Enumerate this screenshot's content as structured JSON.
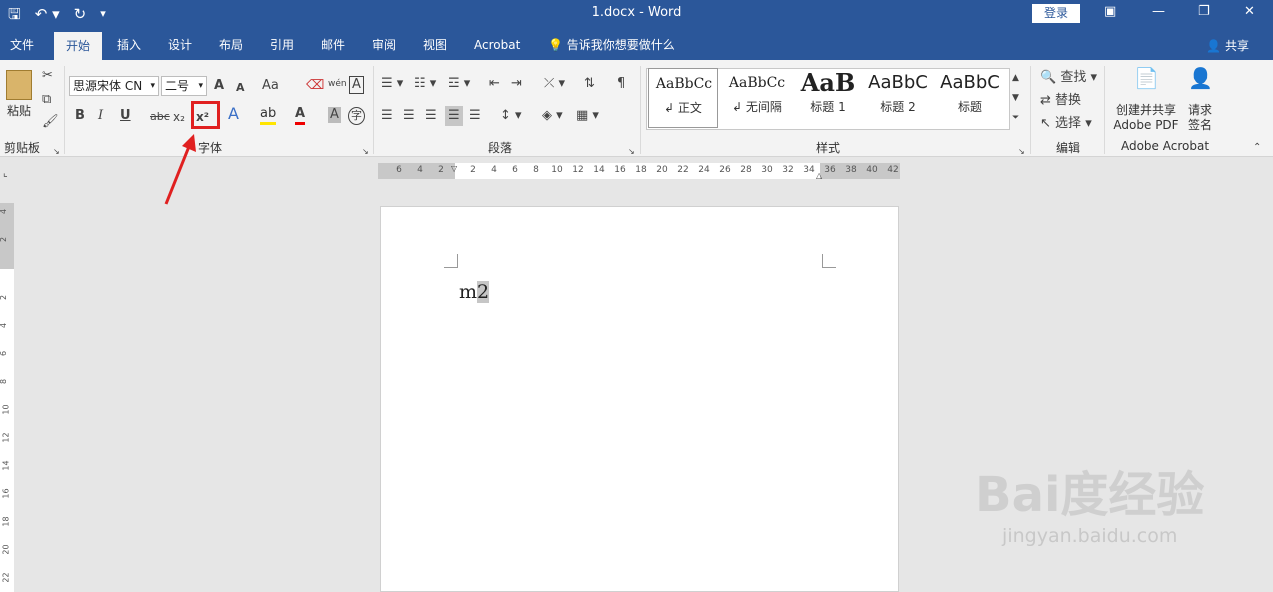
{
  "title_bar": {
    "doc_title": "1.docx  -  Word",
    "login_label": "登录"
  },
  "tabs": [
    "文件",
    "开始",
    "插入",
    "设计",
    "布局",
    "引用",
    "邮件",
    "审阅",
    "视图",
    "Acrobat"
  ],
  "tell_me": "告诉我你想要做什么",
  "share_label": "共享",
  "clipboard": {
    "paste_label": "粘贴",
    "group_label": "剪贴板"
  },
  "font": {
    "font_name": "思源宋体 CN",
    "font_size": "二号",
    "group_label": "字体",
    "bold": "B",
    "italic": "I",
    "underline": "U",
    "strike": "abc",
    "subscript": "x₂",
    "superscript": "x²",
    "grow": "A",
    "shrink": "A",
    "case": "Aa",
    "phonetic": "wén",
    "border_char": "A",
    "text_effects": "A",
    "font_color": "A",
    "char_shading": "A",
    "enclose": "字"
  },
  "paragraph": {
    "group_label": "段落"
  },
  "styles": {
    "group_label": "样式",
    "items": [
      {
        "sample": "AaBbCc",
        "name": "正文"
      },
      {
        "sample": "AaBbCc",
        "name": "无间隔"
      },
      {
        "sample": "AaB",
        "name": "标题 1"
      },
      {
        "sample": "AaBbC",
        "name": "标题 2"
      },
      {
        "sample": "AaBbC",
        "name": "标题"
      }
    ]
  },
  "editing": {
    "find": "查找",
    "replace": "替换",
    "select": "选择",
    "group_label": "编辑"
  },
  "acrobat": {
    "create_line1": "创建并共享",
    "create_line2": "Adobe PDF",
    "sign_line1": "请求",
    "sign_line2": "签名",
    "group_label": "Adobe Acrobat"
  },
  "ruler_top": [
    "6",
    "4",
    "2",
    "2",
    "4",
    "6",
    "8",
    "10",
    "12",
    "14",
    "16",
    "18",
    "20",
    "22",
    "24",
    "26",
    "28",
    "30",
    "32",
    "34",
    "36",
    "38",
    "40",
    "42"
  ],
  "ruler_left": [
    "4",
    "2",
    "2",
    "4",
    "6",
    "8",
    "10",
    "12",
    "14",
    "16",
    "18",
    "20",
    "22"
  ],
  "document": {
    "text_main": "m",
    "text_selected": "2"
  },
  "watermark": {
    "brand": "Bai度经验",
    "url": "jingyan.baidu.com"
  },
  "colors": {
    "accent": "#2b579a",
    "annotation": "#e02020"
  }
}
